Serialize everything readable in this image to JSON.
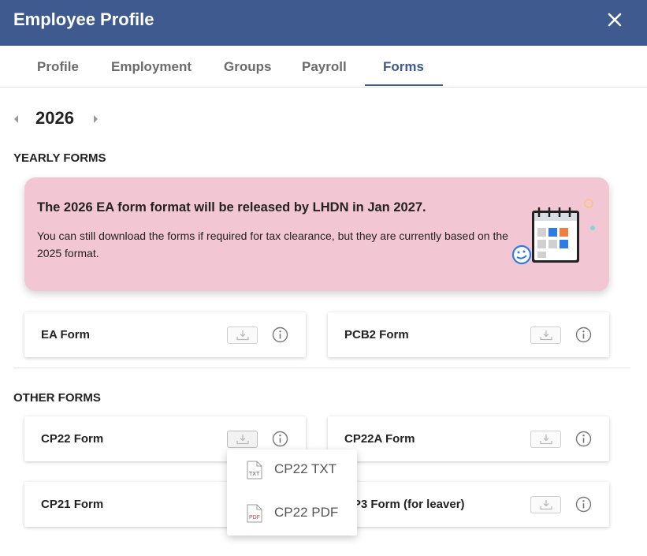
{
  "header": {
    "title": "Employee Profile",
    "close_icon": "close-icon"
  },
  "tabs": [
    {
      "label": "Profile",
      "active": false
    },
    {
      "label": "Employment",
      "active": false
    },
    {
      "label": "Groups",
      "active": false
    },
    {
      "label": "Payroll",
      "active": false
    },
    {
      "label": "Forms",
      "active": true
    }
  ],
  "year": {
    "value": "2026",
    "prev_icon": "caret-left-icon",
    "next_icon": "caret-right-icon"
  },
  "yearly_forms": {
    "title": "YEARLY FORMS",
    "banner": {
      "title": "The 2026 EA form format will be released by LHDN in Jan 2027.",
      "text": "You can still download the forms if required for tax clearance, but they are currently based on the 2025 format.",
      "background": "#f3c6d3",
      "illustration": "calendar-illustration"
    },
    "cards": [
      {
        "label": "EA Form"
      },
      {
        "label": "PCB2 Form"
      }
    ]
  },
  "other_forms": {
    "title": "OTHER FORMS",
    "cards": [
      {
        "label": "CP22 Form"
      },
      {
        "label": "CP22A Form"
      },
      {
        "label": "CP21 Form"
      },
      {
        "label": "CP3 Form (for leaver)"
      }
    ]
  },
  "dropdown": {
    "items": [
      {
        "label": "CP22 TXT",
        "icon": "txt-file-icon"
      },
      {
        "label": "CP22 PDF",
        "icon": "pdf-file-icon"
      }
    ]
  },
  "colors": {
    "primary": "#3e5a8e",
    "banner": "#f3c6d3",
    "accent_blue": "#2d7be5",
    "accent_orange": "#f08040"
  }
}
